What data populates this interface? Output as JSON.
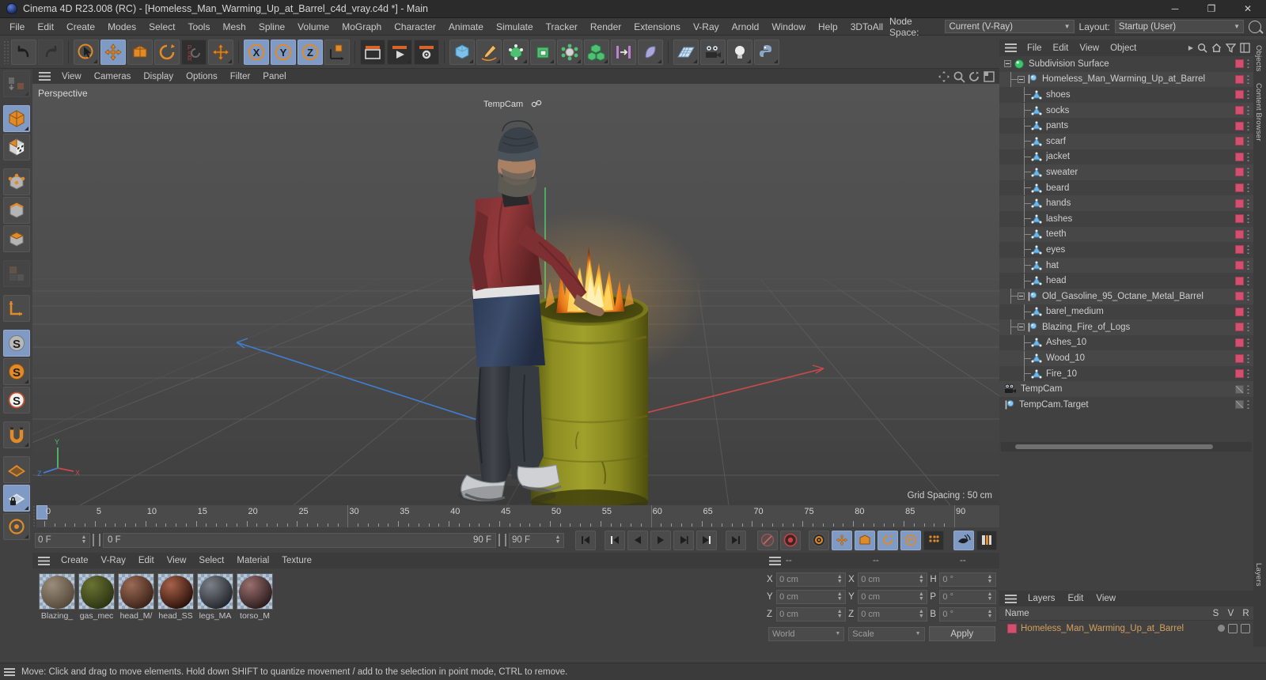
{
  "window": {
    "title": "Cinema 4D R23.008 (RC) - [Homeless_Man_Warming_Up_at_Barrel_c4d_vray.c4d *] - Main",
    "minimize": "─",
    "maximize": "❐",
    "close": "✕"
  },
  "menubar": {
    "items": [
      "File",
      "Edit",
      "Create",
      "Modes",
      "Select",
      "Tools",
      "Mesh",
      "Spline",
      "Volume",
      "MoGraph",
      "Character",
      "Animate",
      "Simulate",
      "Tracker",
      "Render",
      "Extensions",
      "V-Ray",
      "Arnold",
      "Window",
      "Help",
      "3DToAll"
    ],
    "node_space_label": "Node Space:",
    "node_space_value": "Current (V-Ray)",
    "layout_label": "Layout:",
    "layout_value": "Startup (User)"
  },
  "viewport": {
    "menu": [
      "View",
      "Cameras",
      "Display",
      "Options",
      "Filter",
      "Panel"
    ],
    "label": "Perspective",
    "grid_spacing": "Grid Spacing : 50 cm",
    "camera_tag": "TempCam",
    "axis_labels": {
      "x": "X",
      "y": "Y",
      "z": "Z"
    }
  },
  "timeline": {
    "ticks": [
      0,
      5,
      10,
      15,
      20,
      25,
      30,
      35,
      40,
      45,
      50,
      55,
      60,
      65,
      70,
      75,
      80,
      85,
      90
    ],
    "current_frame": "0 F",
    "start_frame": "0 F",
    "end_frame": "90 F",
    "preview_end": "90 F",
    "right_frame_field": "0 F",
    "fps_field": "90 F"
  },
  "material_manager": {
    "menu": [
      "Create",
      "V-Ray",
      "Edit",
      "View",
      "Select",
      "Material",
      "Texture"
    ],
    "materials": [
      {
        "name": "Blazing_",
        "color1": "#9a8d7a",
        "color2": "#55483a"
      },
      {
        "name": "gas_mec",
        "color1": "#6a7333",
        "color2": "#2c3312"
      },
      {
        "name": "head_M/",
        "color1": "#9b6a55",
        "color2": "#3b2218"
      },
      {
        "name": "head_SS",
        "color1": "#a8614a",
        "color2": "#2a1109"
      },
      {
        "name": "legs_MA",
        "color1": "#7c8189",
        "color2": "#23262b"
      },
      {
        "name": "torso_M",
        "color1": "#9a6f6d",
        "color2": "#2b1b1c"
      }
    ]
  },
  "coordinates": {
    "header_dashes": [
      "--",
      "--",
      "--"
    ],
    "rows": [
      {
        "pos_label": "X",
        "pos_value": "0 cm",
        "size_label": "X",
        "size_value": "0 cm",
        "rot_label": "H",
        "rot_value": "0 °"
      },
      {
        "pos_label": "Y",
        "pos_value": "0 cm",
        "size_label": "Y",
        "size_value": "0 cm",
        "rot_label": "P",
        "rot_value": "0 °"
      },
      {
        "pos_label": "Z",
        "pos_value": "0 cm",
        "size_label": "Z",
        "size_value": "0 cm",
        "rot_label": "B",
        "rot_value": "0 °"
      }
    ],
    "system": "World",
    "mode": "Scale",
    "apply_label": "Apply"
  },
  "object_manager": {
    "menu": [
      "File",
      "Edit",
      "View",
      "Object"
    ],
    "rows": [
      {
        "name": "Subdivision Surface",
        "depth": 0,
        "icon": "subdivision-surface",
        "expander": "minus",
        "tag": "pink"
      },
      {
        "name": "Homeless_Man_Warming_Up_at_Barrel",
        "depth": 1,
        "icon": "null-object",
        "expander": "minus",
        "tag": "pink"
      },
      {
        "name": "shoes",
        "depth": 2,
        "icon": "polygon-object",
        "expander": "none",
        "tag": "pink"
      },
      {
        "name": "socks",
        "depth": 2,
        "icon": "polygon-object",
        "expander": "none",
        "tag": "pink"
      },
      {
        "name": "pants",
        "depth": 2,
        "icon": "polygon-object",
        "expander": "none",
        "tag": "pink"
      },
      {
        "name": "scarf",
        "depth": 2,
        "icon": "polygon-object",
        "expander": "none",
        "tag": "pink"
      },
      {
        "name": "jacket",
        "depth": 2,
        "icon": "polygon-object",
        "expander": "none",
        "tag": "pink"
      },
      {
        "name": "sweater",
        "depth": 2,
        "icon": "polygon-object",
        "expander": "none",
        "tag": "pink"
      },
      {
        "name": "beard",
        "depth": 2,
        "icon": "polygon-object",
        "expander": "none",
        "tag": "pink"
      },
      {
        "name": "hands",
        "depth": 2,
        "icon": "polygon-object",
        "expander": "none",
        "tag": "pink"
      },
      {
        "name": "lashes",
        "depth": 2,
        "icon": "polygon-object",
        "expander": "none",
        "tag": "pink"
      },
      {
        "name": "teeth",
        "depth": 2,
        "icon": "polygon-object",
        "expander": "none",
        "tag": "pink"
      },
      {
        "name": "eyes",
        "depth": 2,
        "icon": "polygon-object",
        "expander": "none",
        "tag": "pink"
      },
      {
        "name": "hat",
        "depth": 2,
        "icon": "polygon-object",
        "expander": "none",
        "tag": "pink"
      },
      {
        "name": "head",
        "depth": 2,
        "icon": "polygon-object",
        "expander": "none",
        "tag": "pink"
      },
      {
        "name": "Old_Gasoline_95_Octane_Metal_Barrel",
        "depth": 1,
        "icon": "null-object",
        "expander": "minus",
        "tag": "pink"
      },
      {
        "name": "barel_medium",
        "depth": 2,
        "icon": "polygon-object",
        "expander": "none",
        "tag": "pink"
      },
      {
        "name": "Blazing_Fire_of_Logs",
        "depth": 1,
        "icon": "null-object",
        "expander": "minus",
        "tag": "pink"
      },
      {
        "name": "Ashes_10",
        "depth": 2,
        "icon": "polygon-object",
        "expander": "none",
        "tag": "pink"
      },
      {
        "name": "Wood_10",
        "depth": 2,
        "icon": "polygon-object",
        "expander": "none",
        "tag": "pink"
      },
      {
        "name": "Fire_10",
        "depth": 2,
        "icon": "polygon-object",
        "expander": "none",
        "tag": "pink"
      },
      {
        "name": "TempCam",
        "depth": 0,
        "icon": "camera",
        "expander": "none",
        "tag": "gray"
      },
      {
        "name": "TempCam.Target",
        "depth": 0,
        "icon": "null-object",
        "expander": "none",
        "tag": "gray"
      }
    ]
  },
  "layer_manager": {
    "menu": [
      "Layers",
      "Edit",
      "View"
    ],
    "columns": [
      "Name",
      "S",
      "V",
      "R"
    ],
    "rows": [
      {
        "name": "Homeless_Man_Warming_Up_at_Barrel",
        "color": "#d2506e"
      }
    ]
  },
  "right_tabs": [
    "Objects",
    "Content Browser",
    "Layers"
  ],
  "statusbar": {
    "text": "Move: Click and drag to move elements. Hold down SHIFT to quantize movement / add to the selection in point mode, CTRL to remove."
  },
  "colors": {
    "accent_blue": "#7f9ac4",
    "orange": "#e08a28",
    "tag_pink": "#d2506e",
    "panel_bg": "#414141",
    "viewport_bg": "#4b4b4b"
  }
}
